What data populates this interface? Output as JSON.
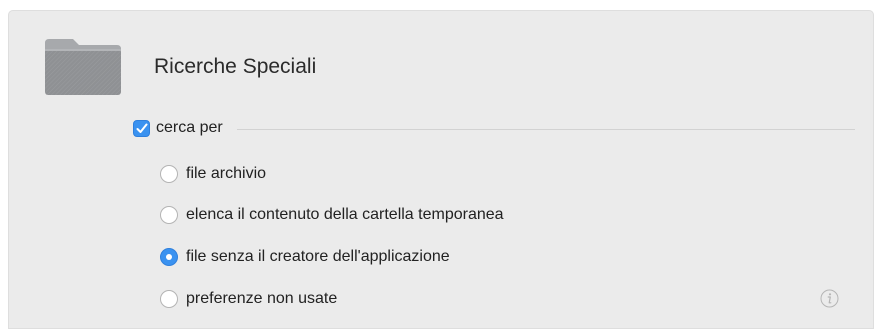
{
  "header": {
    "title": "Ricerche Speciali",
    "icon": "folder-icon"
  },
  "section": {
    "label": "cerca per",
    "checked": true
  },
  "options": [
    {
      "label": "file archivio",
      "selected": false
    },
    {
      "label": "elenca il contenuto della cartella temporanea",
      "selected": false
    },
    {
      "label": "file senza il creatore dell'applicazione",
      "selected": true
    },
    {
      "label": "preferenze non usate",
      "selected": false
    }
  ],
  "info": {
    "icon": "info-icon"
  },
  "colors": {
    "accent": "#3a92f0",
    "panel": "#ebebeb"
  }
}
